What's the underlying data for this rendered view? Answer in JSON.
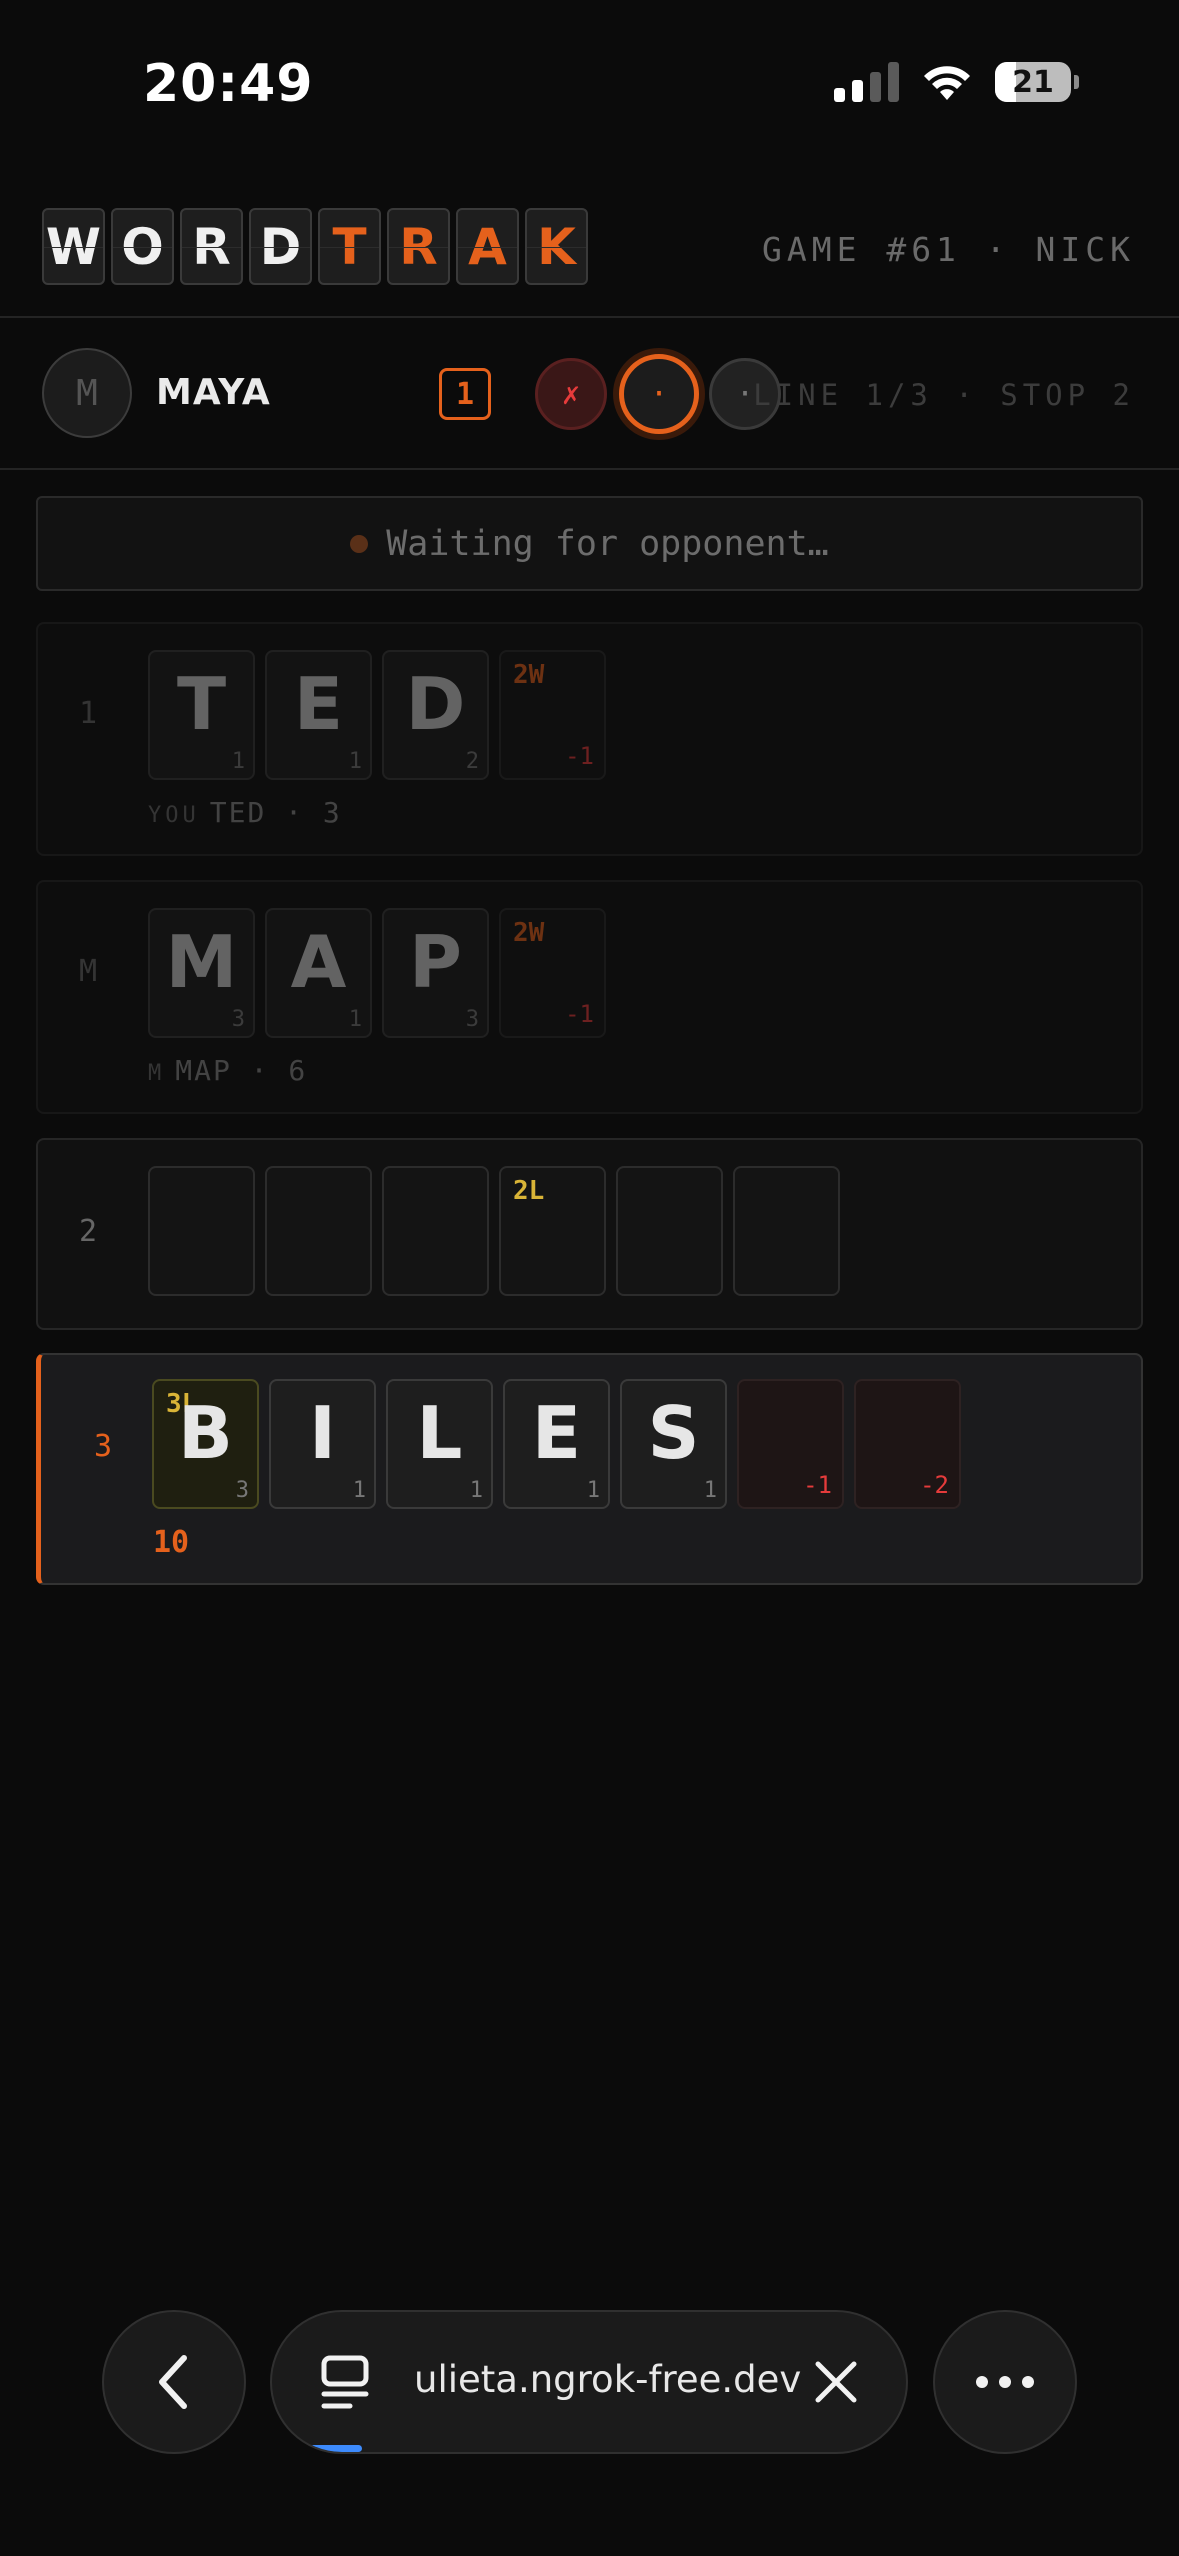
{
  "status_bar": {
    "time": "20:49",
    "battery": "21"
  },
  "header": {
    "logo_letters": [
      "W",
      "O",
      "R",
      "D",
      "T",
      "R",
      "A",
      "K"
    ],
    "game_info": "GAME #61 · NICK"
  },
  "opponent": {
    "avatar_initial": "M",
    "name": "MAYA",
    "round_badge": "1",
    "stop_markers": [
      "✗",
      "·",
      "·"
    ],
    "line_info": "LINE 1/3 · STOP 2"
  },
  "waiting_text": "Waiting for opponent…",
  "rows": [
    {
      "label": "1",
      "tiles": [
        {
          "letter": "T",
          "points": "1"
        },
        {
          "letter": "E",
          "points": "1"
        },
        {
          "letter": "D",
          "points": "2"
        },
        {
          "bonus": "2W",
          "penalty": "-1"
        }
      ],
      "sub_who": "YOU",
      "sub_text": "TED · 3"
    },
    {
      "label": "M",
      "tiles": [
        {
          "letter": "M",
          "points": "3"
        },
        {
          "letter": "A",
          "points": "1"
        },
        {
          "letter": "P",
          "points": "3"
        },
        {
          "bonus": "2W",
          "penalty": "-1"
        }
      ],
      "sub_who": "M",
      "sub_text": "MAP · 6"
    },
    {
      "label": "2",
      "tiles": [
        {},
        {},
        {},
        {
          "bonus": "2L"
        },
        {},
        {}
      ]
    },
    {
      "label": "3",
      "tiles": [
        {
          "letter": "B",
          "points": "3",
          "bonus": "3L"
        },
        {
          "letter": "I",
          "points": "1"
        },
        {
          "letter": "L",
          "points": "1"
        },
        {
          "letter": "E",
          "points": "1"
        },
        {
          "letter": "S",
          "points": "1"
        },
        {
          "penalty": "-1"
        },
        {
          "penalty": "-2"
        }
      ],
      "score": "10"
    }
  ],
  "browser": {
    "url": "ulieta.ngrok-free.dev"
  },
  "icons": {
    "back": "chevron-left-icon",
    "tabs": "tabs-icon",
    "close": "close-icon",
    "more": "more-icon",
    "wifi": "wifi-icon",
    "signal": "cellular-signal-icon",
    "battery": "battery-icon"
  },
  "colors": {
    "accent": "#e5611c",
    "bonus_letter": "#d9b437",
    "penalty": "#e53b3b",
    "background": "#0b0b0b"
  }
}
